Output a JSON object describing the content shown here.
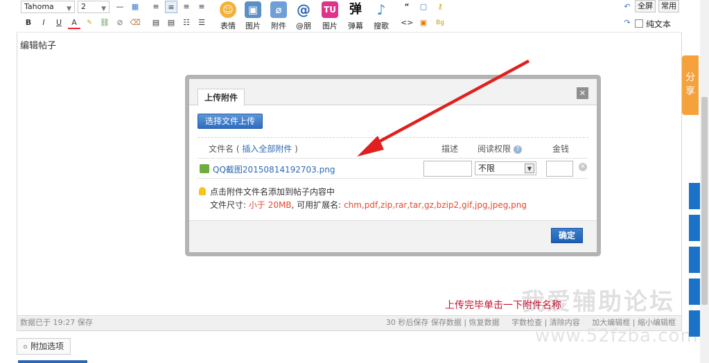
{
  "toolbar": {
    "font_family": "Tahoma",
    "font_size": "2",
    "format_buttons": [
      "B",
      "I",
      "U",
      "A"
    ],
    "big_buttons": [
      {
        "label": "表情",
        "icon": "smiley-icon",
        "color": "#f3b13a",
        "glyph": "☺"
      },
      {
        "label": "图片",
        "icon": "image-icon",
        "color": "#5a8fc7",
        "glyph": "▣"
      },
      {
        "label": "附件",
        "icon": "paperclip-icon",
        "color": "#6f9fd6",
        "glyph": "⌀"
      },
      {
        "label": "@朋",
        "icon": "at-icon",
        "color": "#2b68b4",
        "glyph": "@"
      },
      {
        "label": "图片",
        "icon": "tu-icon",
        "color": "#e0328a",
        "glyph": "TU"
      },
      {
        "label": "弹幕",
        "icon": "danmu-icon",
        "color": "#111111",
        "glyph": "弹"
      },
      {
        "label": "搜歌",
        "icon": "music-note-icon",
        "color": "#2c8fe0",
        "glyph": "♪"
      }
    ],
    "fullscreen_label": "全屏",
    "common_label": "常用",
    "plaintext_label": "纯文本"
  },
  "editor": {
    "content": "编辑帖子",
    "status_left": "数据已于 19:27 保存",
    "status_links": [
      "30 秒后保存 保存数据",
      "恢复数据",
      "字数检查",
      "清除内容",
      "加大编辑框",
      "缩小编辑框"
    ]
  },
  "annotation": "上传完毕单击一下附件名称",
  "watermark": {
    "line1": "我爱辅助论坛",
    "line2": "www.52fzba.com"
  },
  "addon_button": "附加选项",
  "share_label": "分享",
  "dialog": {
    "tab": "上传附件",
    "upload_button": "选择文件上传",
    "columns": {
      "filename": "文件名",
      "insert_all": "插入全部附件",
      "desc": "描述",
      "permission": "阅读权限",
      "price": "金钱"
    },
    "file": {
      "name": "QQ截图20150814192703.png",
      "permission": "不限"
    },
    "tip_line1": "点击附件文件名添加到帖子内容中",
    "tip_size_label": "文件尺寸:",
    "tip_size_value": "小于 20MB",
    "tip_ext_label": ", 可用扩展名:",
    "tip_ext_value": "chm,pdf,zip,rar,tar,gz,bzip2,gif,jpg,jpeg,png",
    "ok_button": "确定"
  },
  "colors": {
    "accent": "#2b68b4",
    "annotation": "#c8102e",
    "arrow": "#e02020",
    "share": "#f5a23c"
  }
}
